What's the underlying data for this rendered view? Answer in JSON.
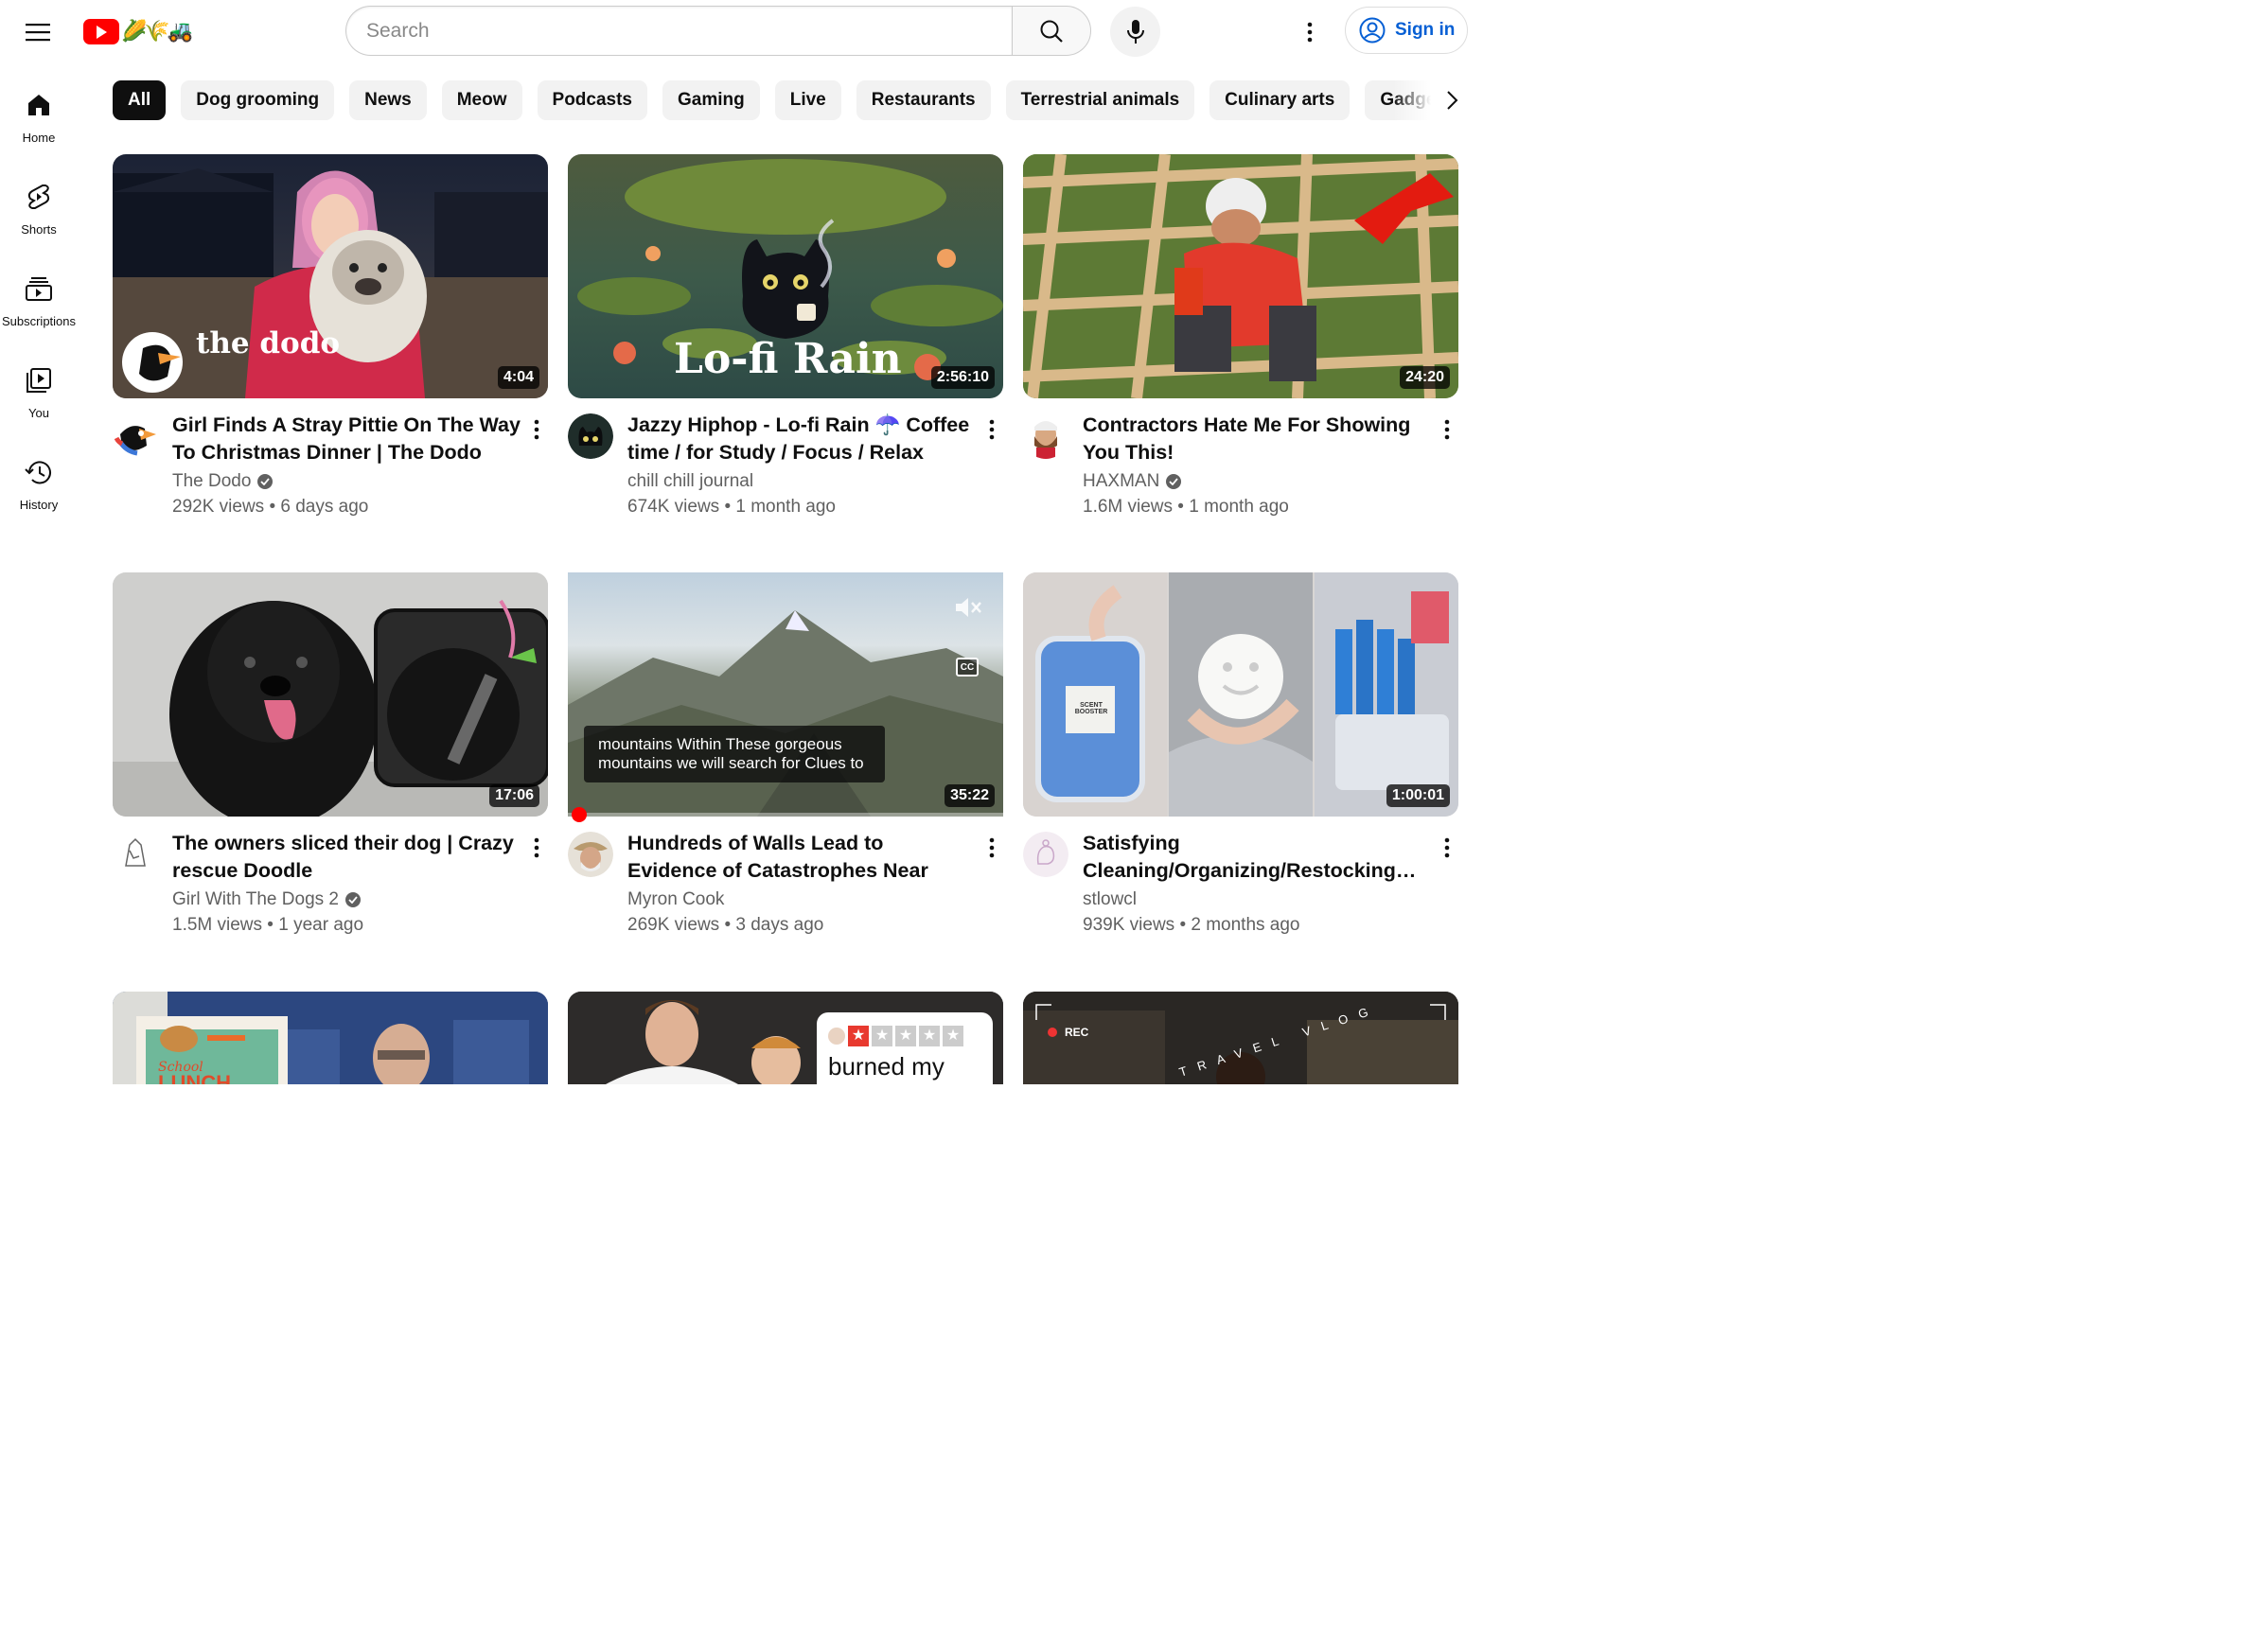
{
  "header": {
    "search_placeholder": "Search",
    "signin_label": "Sign in",
    "logo_doodle": "🌽🌾🚜"
  },
  "sidebar": {
    "items": [
      {
        "label": "Home",
        "icon": "home-icon"
      },
      {
        "label": "Shorts",
        "icon": "shorts-icon"
      },
      {
        "label": "Subscriptions",
        "icon": "subscriptions-icon"
      },
      {
        "label": "You",
        "icon": "you-icon"
      },
      {
        "label": "History",
        "icon": "history-icon"
      }
    ]
  },
  "chips": [
    "All",
    "Dog grooming",
    "News",
    "Meow",
    "Podcasts",
    "Gaming",
    "Live",
    "Restaurants",
    "Terrestrial animals",
    "Culinary arts",
    "Gadgets"
  ],
  "videos": [
    {
      "title": "Girl Finds A Stray Pittie On The Way To Christmas Dinner | The Dodo",
      "channel": "The Dodo",
      "verified": true,
      "stats": "292K views • 6 days ago",
      "duration": "4:04",
      "overlay": "the dodo"
    },
    {
      "title": "Jazzy Hiphop - Lo-fi Rain ☂️ Coffee time / for Study / Focus / Relax",
      "channel": "chill chill journal",
      "verified": false,
      "stats": "674K views • 1 month ago",
      "duration": "2:56:10",
      "overlay": "Lo-fi Rain"
    },
    {
      "title": "Contractors Hate Me For Showing You This!",
      "channel": "HAXMAN",
      "verified": true,
      "stats": "1.6M views • 1 month ago",
      "duration": "24:20"
    },
    {
      "title": "The owners sliced their dog | Crazy rescue Doodle",
      "channel": "Girl With The Dogs 2",
      "verified": true,
      "stats": "1.5M views • 1 year ago",
      "duration": "17:06"
    },
    {
      "title": "Hundreds of Walls Lead to Evidence of Catastrophes Near Yellowstone",
      "channel": "Myron Cook",
      "verified": false,
      "stats": "269K views • 3 days ago",
      "duration": "35:22",
      "caption": "mountains Within These gorgeous mountains we will search for Clues to"
    },
    {
      "title": "Satisfying Cleaning/Organizing/Restocking…",
      "channel": "stlowcl",
      "verified": false,
      "stats": "939K views • 2 months ago",
      "duration": "1:00:01",
      "overlay": "SCENT BOOSTER"
    }
  ],
  "partial_row": {
    "school_text": "School",
    "lunch_text": "LUNCH",
    "burned_text": "burned my",
    "rec_text": "REC",
    "travel_text": "TRAVEL VLOG"
  },
  "colors": {
    "accent": "#ff0000",
    "link": "#065fd4",
    "text_secondary": "#606060"
  }
}
